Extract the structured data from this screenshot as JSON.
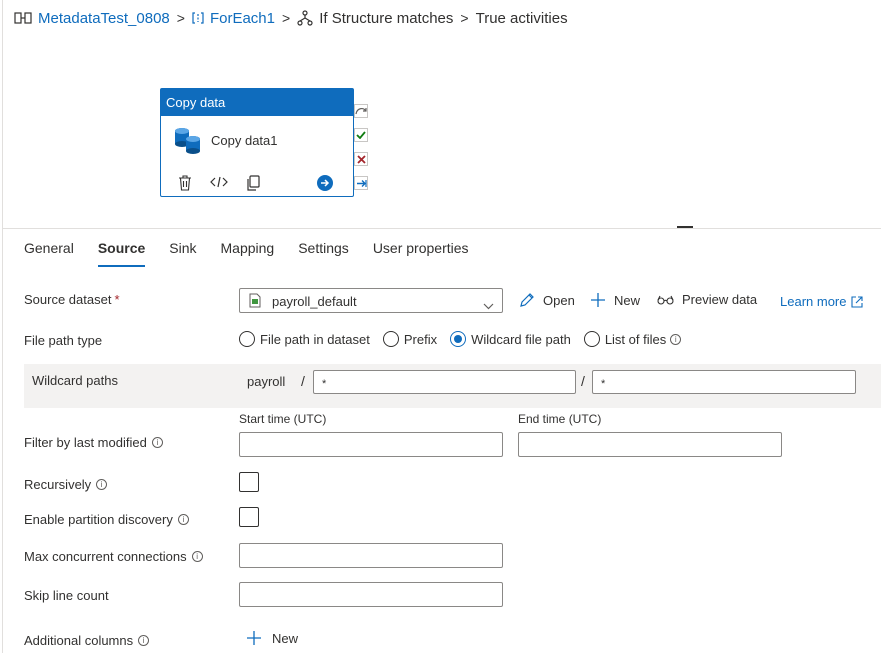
{
  "breadcrumb": {
    "pipeline": "MetadataTest_0808",
    "foreach": "ForEach1",
    "condition": "If Structure matches",
    "current": "True activities",
    "separator": ">"
  },
  "activity": {
    "type": "Copy data",
    "name": "Copy data1"
  },
  "tabs": [
    "General",
    "Source",
    "Sink",
    "Mapping",
    "Settings",
    "User properties"
  ],
  "active_tab": "Source",
  "source": {
    "dataset_label": "Source dataset",
    "required_mark": "*",
    "dataset_value": "payroll_default",
    "open_label": "Open",
    "new_label": "New",
    "preview_label": "Preview data",
    "learn_more_label": "Learn more",
    "file_path_type_label": "File path type",
    "file_path_options": [
      "File path in dataset",
      "Prefix",
      "Wildcard file path",
      "List of files"
    ],
    "file_path_selected": "Wildcard file path",
    "wildcard_label": "Wildcard paths",
    "wildcard_prefix": "payroll",
    "wildcard_separator": "/",
    "wildcard_folder": "*",
    "wildcard_file": "*",
    "start_time_label": "Start time (UTC)",
    "end_time_label": "End time (UTC)",
    "filter_label": "Filter by last modified",
    "recursively_label": "Recursively",
    "partition_label": "Enable partition discovery",
    "max_conn_label": "Max concurrent connections",
    "skip_line_label": "Skip line count",
    "additional_columns_label": "Additional columns",
    "additional_new_label": "New"
  },
  "colors": {
    "accent": "#0f6cbd",
    "success": "#107c10",
    "error": "#a4262c"
  }
}
